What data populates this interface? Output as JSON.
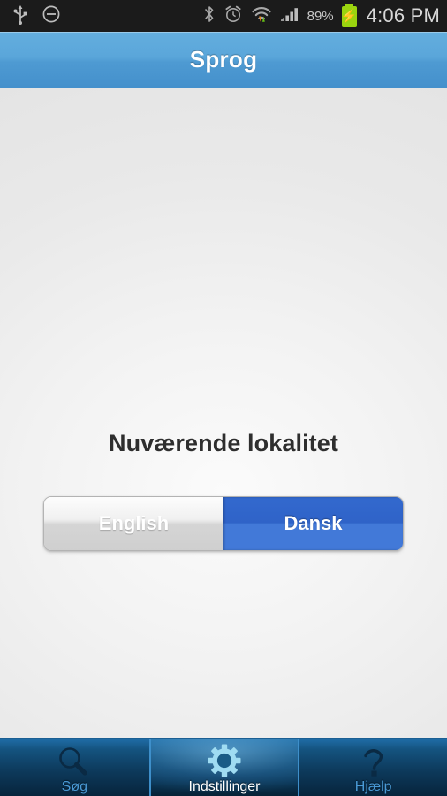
{
  "statusbar": {
    "left_icons": [
      {
        "name": "usb-icon",
        "glyph": "usb"
      },
      {
        "name": "mute-icon",
        "glyph": "circle-minus"
      }
    ],
    "right_icons": [
      {
        "name": "bluetooth-icon",
        "glyph": "bluetooth"
      },
      {
        "name": "alarm-clock-icon",
        "glyph": "alarm"
      },
      {
        "name": "wifi-icon",
        "glyph": "wifi-transfer"
      },
      {
        "name": "cellular-signal-icon",
        "glyph": "signal-bars"
      }
    ],
    "battery_percent": "89%",
    "battery_state": "charging",
    "clock": "4:06 PM"
  },
  "header": {
    "title": "Sprog"
  },
  "main": {
    "heading": "Nuværende lokalitet",
    "language_toggle": {
      "name": "language-segmented-control",
      "selected": "Dansk",
      "options": [
        {
          "label": "English",
          "value": "en",
          "selected": false
        },
        {
          "label": "Dansk",
          "value": "da",
          "selected": true
        }
      ]
    }
  },
  "tabbar": {
    "active": "Indstillinger",
    "tabs": [
      {
        "label": "Søg",
        "icon": "search-icon",
        "active": false
      },
      {
        "label": "Indstillinger",
        "icon": "gear-icon",
        "active": true
      },
      {
        "label": "Hjælp",
        "icon": "help-icon",
        "active": false
      }
    ]
  },
  "colors": {
    "header_blue": "#4e9ad2",
    "accent_blue": "#3369ce",
    "tabbar_dark": "#0d3a5c",
    "tab_label": "#4a9ad6",
    "battery_green": "#9ad40f"
  }
}
